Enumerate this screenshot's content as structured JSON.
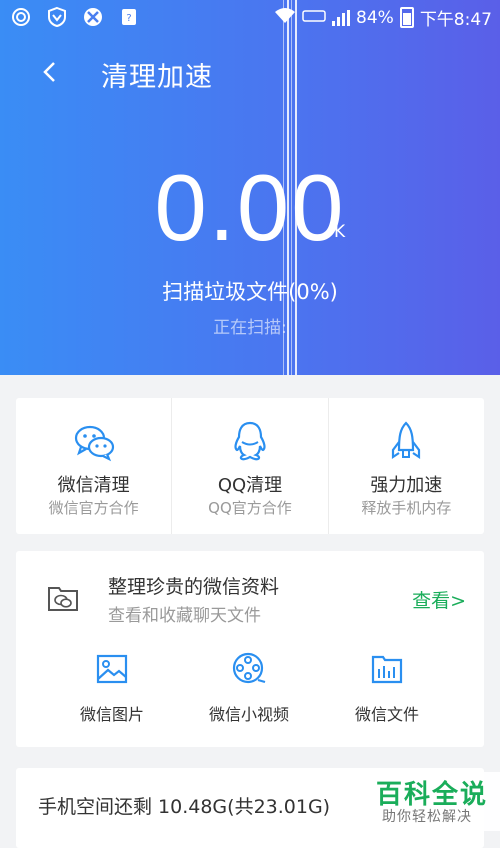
{
  "status_bar": {
    "battery": "84%",
    "time": "下午8:47"
  },
  "header": {
    "title": "清理加速",
    "size_value": "0.00",
    "size_unit": "K",
    "scan_label": "扫描垃圾文件(0%)",
    "scan_status": "正在扫描:"
  },
  "tools": [
    {
      "title": "微信清理",
      "subtitle": "微信官方合作",
      "icon": "wechat-icon"
    },
    {
      "title": "QQ清理",
      "subtitle": "QQ官方合作",
      "icon": "qq-penguin-icon"
    },
    {
      "title": "强力加速",
      "subtitle": "释放手机内存",
      "icon": "rocket-icon"
    }
  ],
  "wechat_card": {
    "title": "整理珍贵的微信资料",
    "subtitle": "查看和收藏聊天文件",
    "view_label": "查看>",
    "items": [
      {
        "label": "微信图片",
        "icon": "image-icon"
      },
      {
        "label": "微信小视频",
        "icon": "film-reel-icon"
      },
      {
        "label": "微信文件",
        "icon": "file-folder-icon"
      }
    ]
  },
  "storage": {
    "text": "手机空间还剩 10.48G(共23.01G)"
  },
  "watermark": {
    "title": "百科全说",
    "subtitle": "助你轻松解决"
  },
  "colors": {
    "header_start": "#3a8df5",
    "header_end": "#5a5fe8",
    "accent_blue": "#2a8ff0",
    "link_green": "#1aad5a"
  }
}
